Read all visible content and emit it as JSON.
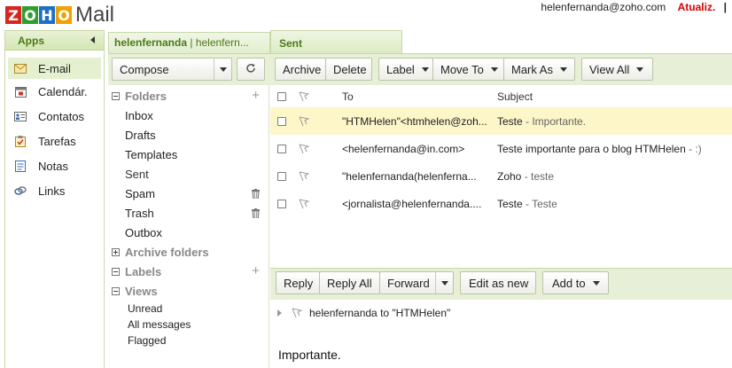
{
  "logo": {
    "letters": [
      "Z",
      "O",
      "H",
      "O"
    ],
    "colors": [
      "#d8261e",
      "#2f9e2f",
      "#1f6fc5",
      "#f2a100"
    ],
    "text": "Mail"
  },
  "user": {
    "email": "helenfernanda@zoho.com",
    "update_label": "Atualiz.",
    "separator": "|"
  },
  "apps": {
    "title": "Apps",
    "items": [
      {
        "label": "E-mail",
        "icon": "envelope-icon",
        "active": true
      },
      {
        "label": "Calendár.",
        "icon": "calendar-icon"
      },
      {
        "label": "Contatos",
        "icon": "contacts-icon"
      },
      {
        "label": "Tarefas",
        "icon": "tasks-icon"
      },
      {
        "label": "Notas",
        "icon": "notes-icon"
      },
      {
        "label": "Links",
        "icon": "links-icon"
      }
    ]
  },
  "tabs": {
    "account": "helenfernanda",
    "account_sep": " | helenfern...",
    "current": "Sent"
  },
  "toolbar": {
    "compose": "Compose",
    "refresh_icon": "refresh-icon",
    "archive": "Archive",
    "delete": "Delete",
    "label": "Label",
    "move_to": "Move To",
    "mark_as": "Mark As",
    "view_all": "View All"
  },
  "folders": {
    "title": "Folders",
    "items": [
      "Inbox",
      "Drafts",
      "Templates",
      "Sent",
      "Spam",
      "Trash",
      "Outbox"
    ],
    "archive_title": "Archive folders",
    "labels_title": "Labels",
    "views_title": "Views",
    "views": [
      "Unread",
      "All messages",
      "Flagged"
    ]
  },
  "list": {
    "col_to": "To",
    "col_subject": "Subject",
    "rows": [
      {
        "to": "\"HTMHelen\"<htmhelen@zoh...",
        "subject": "Teste",
        "snippet": " - Importante.",
        "highlight": true
      },
      {
        "to": "<helenfernanda@in.com>",
        "subject": "Teste importante para o blog HTMHelen",
        "snippet": "  - :)"
      },
      {
        "to": "\"helenfernanda(helenferna...",
        "subject": "Zoho",
        "snippet": "  - teste"
      },
      {
        "to": "<jornalista@helenfernanda....",
        "subject": "Teste",
        "snippet": "  - Teste"
      }
    ]
  },
  "actions": {
    "reply": "Reply",
    "reply_all": "Reply All",
    "forward": "Forward",
    "edit_as_new": "Edit as new",
    "add_to": "Add to"
  },
  "preview": {
    "header": "helenfernanda to \"HTMHelen\"",
    "body": "Importante."
  }
}
